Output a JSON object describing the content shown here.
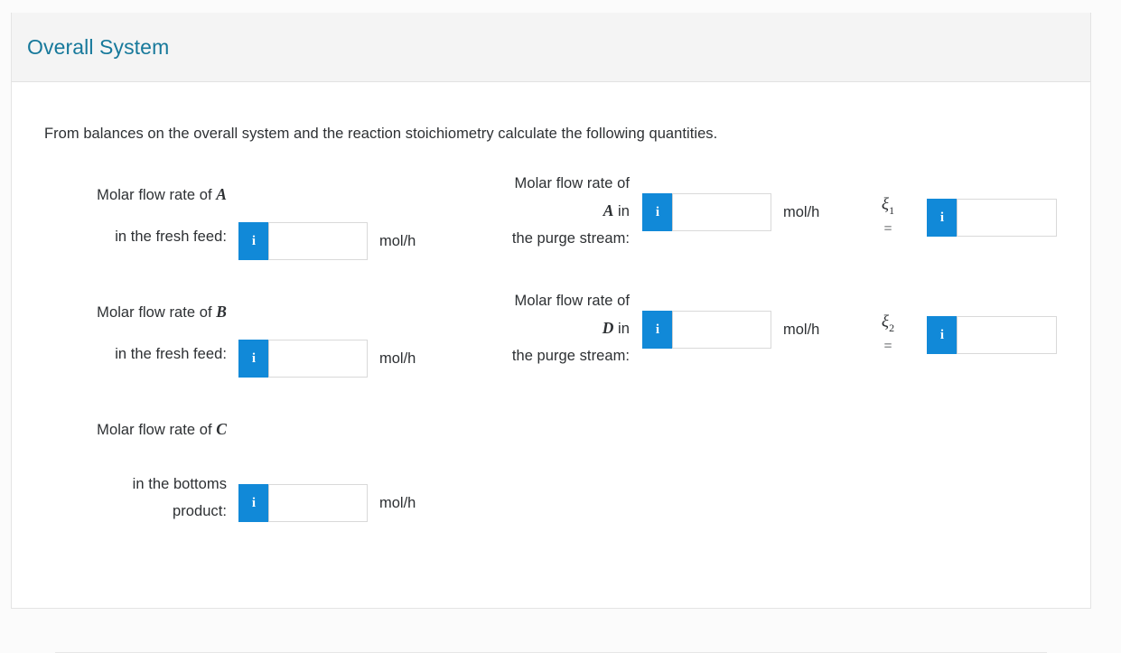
{
  "card": {
    "title": "Overall System",
    "intro": "From balances on the overall system and the reaction stoichiometry calculate the following quantities."
  },
  "theme": {
    "title_color": "#17799b",
    "accent_blue": "#1189d8",
    "header_bg": "#f4f4f4",
    "text_color": "#2d3033",
    "page_bg": "#fbfbfb",
    "input_border": "#d9d9d9"
  },
  "icons": {
    "info": "i",
    "info_name": "info-icon"
  },
  "questions": {
    "col1": [
      {
        "line1_prefix": "Molar flow rate of ",
        "line1_var": "A",
        "line2": "in the fresh feed:",
        "value": "",
        "placeholder": "",
        "units": "mol/h"
      },
      {
        "line1_prefix": "Molar flow rate of ",
        "line1_var": "B",
        "line2": "in the fresh feed:",
        "value": "",
        "placeholder": "",
        "units": "mol/h"
      },
      {
        "line1_prefix": "Molar flow rate of ",
        "line1_var": "C",
        "line2": "in the bottoms",
        "line3": "product:",
        "value": "",
        "placeholder": "",
        "units": "mol/h"
      }
    ],
    "col2": [
      {
        "line1": "Molar flow rate of",
        "line2_var": "A",
        "line2_suffix": " in",
        "line3": "the purge stream:",
        "value": "",
        "placeholder": "",
        "units": "mol/h"
      },
      {
        "line1": "Molar flow rate of",
        "line2_var": "D",
        "line2_suffix": " in",
        "line3": "the purge stream:",
        "value": "",
        "placeholder": "",
        "units": "mol/h"
      }
    ],
    "col3": [
      {
        "symbol": "ξ",
        "subscript": "1",
        "equals": "=",
        "value": "",
        "placeholder": ""
      },
      {
        "symbol": "ξ",
        "subscript": "2",
        "equals": "=",
        "value": "",
        "placeholder": ""
      }
    ]
  }
}
